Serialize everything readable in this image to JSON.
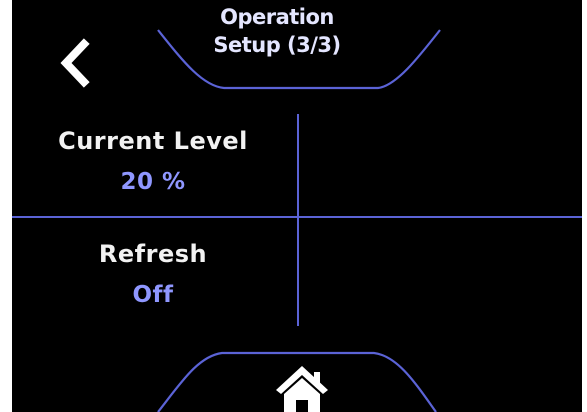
{
  "header": {
    "title_line1": "Operation",
    "title_line2": "Setup (3/3)",
    "back_icon": "chevron-left-icon"
  },
  "settings": [
    {
      "label": "Current Level",
      "value": "20 %"
    },
    {
      "label": "Refresh",
      "value": "Off"
    }
  ],
  "footer": {
    "home_icon": "home-icon"
  },
  "colors": {
    "accent_line": "#5b63d6",
    "value_text": "#8f97ff",
    "label_text": "#f2f2f2",
    "background": "#000000"
  }
}
